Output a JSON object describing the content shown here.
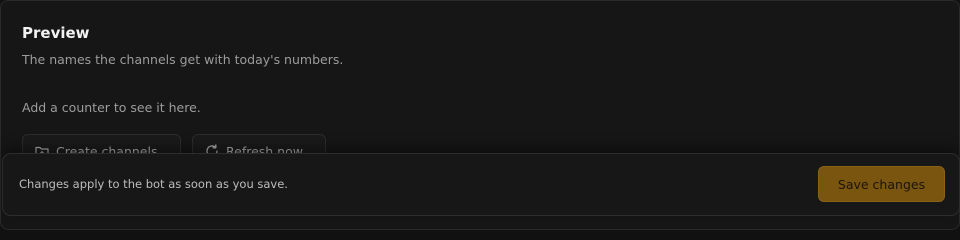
{
  "preview": {
    "title": "Preview",
    "description": "The names the channels get with today's numbers.",
    "empty_message": "Add a counter to see it here.",
    "create_label": "Create channels",
    "create_icon": "folder-plus-icon",
    "refresh_label": "Refresh now",
    "refresh_icon": "refresh-icon"
  },
  "save_bar": {
    "message": "Changes apply to the bot as soon as you save.",
    "save_label": "Save changes",
    "accent_color": "#7a5510"
  }
}
